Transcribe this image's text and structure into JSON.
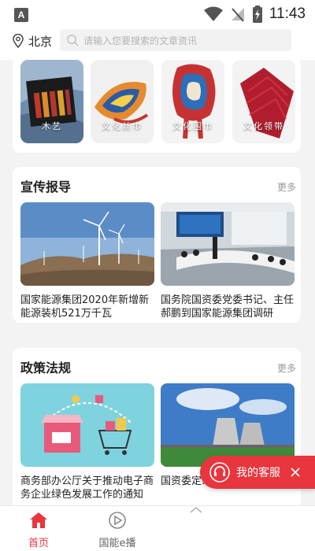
{
  "status_bar": {
    "time": "11:43",
    "app_badge": "A"
  },
  "header": {
    "city": "北京",
    "search_placeholder": "请输入您要搜索的文章资讯"
  },
  "categories": [
    {
      "label": "木艺"
    },
    {
      "label": "文化丝巾"
    },
    {
      "label": "文化围巾"
    },
    {
      "label": "文化领带"
    }
  ],
  "sections": [
    {
      "title": "宣传报导",
      "more": "更多",
      "news": [
        {
          "title": "国家能源集团2020年新增新能源装机521万千瓦"
        },
        {
          "title": "国务院国资委党委书记、主任郝鹏到国家能源集团调研"
        }
      ]
    },
    {
      "title": "政策法规",
      "more": "更多",
      "news": [
        {
          "title": "商务部办公厅关于推动电子商务企业绿色发展工作的通知"
        },
        {
          "title": "国资委定…大重点任务"
        }
      ]
    }
  ],
  "customer_service": {
    "label": "我的客服"
  },
  "tab_bar": {
    "tabs": [
      {
        "label": "首页",
        "icon": "home-icon",
        "active": true
      },
      {
        "label": "国能e播",
        "icon": "play-icon",
        "active": false
      }
    ],
    "accent": "#e8353e"
  }
}
